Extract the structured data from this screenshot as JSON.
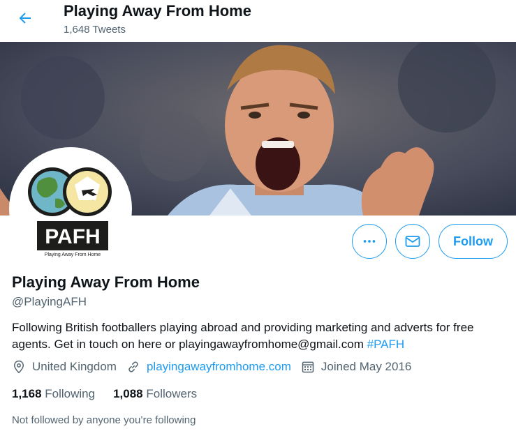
{
  "header": {
    "title": "Playing Away From Home",
    "tweet_count": "1,648 Tweets"
  },
  "avatar": {
    "logo_text": "PAFH",
    "logo_subtext": "Playing Away From Home"
  },
  "actions": {
    "follow_label": "Follow"
  },
  "profile": {
    "name": "Playing Away From Home",
    "handle": "@PlayingAFH",
    "bio_text": "Following British footballers playing abroad and providing marketing and adverts for free agents. Get in touch on here or playingawayfromhome@gmail.com ",
    "bio_hashtag": "#PAFH",
    "location": "United Kingdom",
    "website": "playingawayfromhome.com",
    "joined": "Joined May 2016",
    "following_count": "1,168",
    "following_label": "Following",
    "followers_count": "1,088",
    "followers_label": "Followers",
    "not_followed": "Not followed by anyone you’re following"
  },
  "colors": {
    "accent": "#1d9bf0",
    "secondary_text": "#536471",
    "primary_text": "#0f1419"
  },
  "icons": [
    "back-arrow-icon",
    "more-icon",
    "mail-icon",
    "location-icon",
    "link-icon",
    "calendar-icon"
  ]
}
